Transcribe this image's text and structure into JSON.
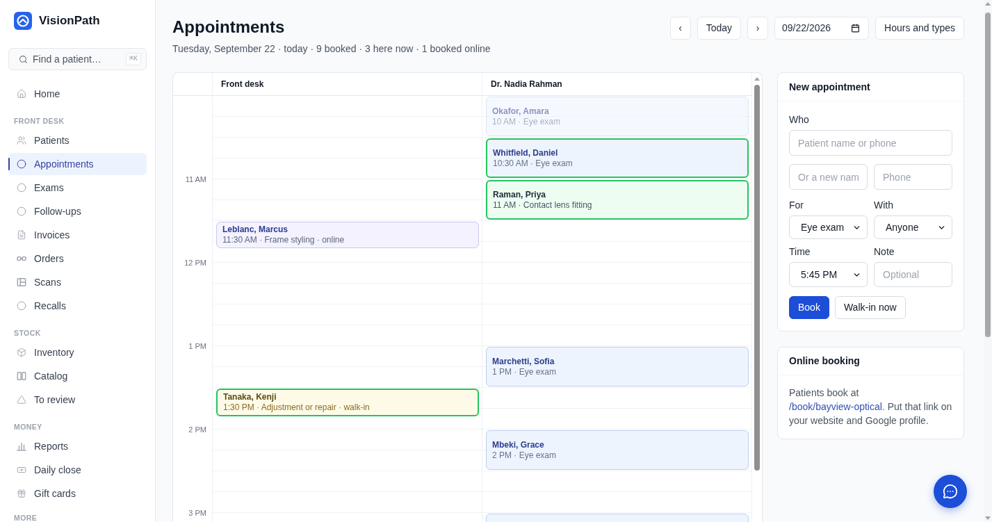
{
  "sidebar": {
    "brand": "VisionPath",
    "search": {
      "placeholder": "Find a patient…",
      "shortcut": "⌘K"
    },
    "sections": [
      {
        "items": [
          {
            "label": "Home",
            "selected": false
          }
        ]
      },
      {
        "title": "FRONT DESK",
        "items": [
          {
            "label": "Patients",
            "selected": false
          },
          {
            "label": "Appointments",
            "selected": true
          },
          {
            "label": "Exams",
            "selected": false
          },
          {
            "label": "Follow-ups",
            "selected": false
          },
          {
            "label": "Invoices",
            "selected": false
          },
          {
            "label": "Orders",
            "selected": false
          },
          {
            "label": "Scans",
            "selected": false
          },
          {
            "label": "Recalls",
            "selected": false
          }
        ]
      },
      {
        "title": "STOCK",
        "items": [
          {
            "label": "Inventory",
            "selected": false
          },
          {
            "label": "Catalog",
            "selected": false
          },
          {
            "label": "To review",
            "selected": false
          }
        ]
      },
      {
        "title": "MONEY",
        "items": [
          {
            "label": "Reports",
            "selected": false
          },
          {
            "label": "Daily close",
            "selected": false
          },
          {
            "label": "Gift cards",
            "selected": false
          }
        ]
      },
      {
        "title": "MORE"
      }
    ]
  },
  "header": {
    "title": "Appointments",
    "summary": "Tuesday, September 22 · today · 9 booked · 3 here now · 1 booked online",
    "prev": "‹",
    "today": "Today",
    "next": "›",
    "date": "09/22/2026",
    "hours_button": "Hours and types"
  },
  "calendar": {
    "hours": [
      "11 AM",
      "12 PM",
      "1 PM",
      "2 PM",
      "3 PM"
    ],
    "columns": [
      {
        "title": "Front desk",
        "slots": [
          {
            "kind": "open"
          },
          {
            "kind": "open"
          },
          {
            "kind": "open"
          },
          {
            "kind": "open"
          },
          {
            "kind": "open"
          },
          {
            "kind": "open"
          },
          {
            "kind": "styling",
            "name": "Leblanc, Marcus",
            "detail": "11:30 AM · Frame styling · online",
            "here_now": false,
            "past": false
          },
          {
            "kind": "open"
          },
          {
            "kind": "open"
          },
          {
            "kind": "open"
          },
          {
            "kind": "open"
          },
          {
            "kind": "open"
          },
          {
            "kind": "open"
          },
          {
            "kind": "open"
          },
          {
            "kind": "repair",
            "name": "Tanaka, Kenji",
            "detail": "1:30 PM · Adjustment or repair · walk-in",
            "here_now": true,
            "past": false
          },
          {
            "kind": "open"
          },
          {
            "kind": "open"
          },
          {
            "kind": "open"
          },
          {
            "kind": "open"
          },
          {
            "kind": "open"
          },
          {
            "kind": "open"
          }
        ]
      },
      {
        "title": "Dr. Nadia Rahman",
        "slots": [
          {
            "kind": "exam",
            "name": "Okafor, Amara",
            "detail": "10 AM · Eye exam",
            "here_now": false,
            "past": true
          },
          {
            "kind": "open"
          },
          {
            "kind": "exam",
            "name": "Whitfield, Daniel",
            "detail": "10:30 AM · Eye exam",
            "here_now": true,
            "past": false
          },
          {
            "kind": "open"
          },
          {
            "kind": "lens",
            "name": "Raman, Priya",
            "detail": "11 AM · Contact lens fitting",
            "here_now": true,
            "past": false
          },
          {
            "kind": "open"
          },
          {
            "kind": "open"
          },
          {
            "kind": "open"
          },
          {
            "kind": "open"
          },
          {
            "kind": "open"
          },
          {
            "kind": "open"
          },
          {
            "kind": "open"
          },
          {
            "kind": "exam",
            "name": "Marchetti, Sofia",
            "detail": "1 PM · Eye exam",
            "here_now": false,
            "past": false
          },
          {
            "kind": "open"
          },
          {
            "kind": "open"
          },
          {
            "kind": "open"
          },
          {
            "kind": "exam",
            "name": "Mbeki, Grace",
            "detail": "2 PM · Eye exam",
            "here_now": false,
            "past": false
          },
          {
            "kind": "open"
          },
          {
            "kind": "open"
          },
          {
            "kind": "open"
          },
          {
            "kind": "exam",
            "here_now": false,
            "past": false
          }
        ]
      }
    ]
  },
  "new_appointment": {
    "title": "New appointment",
    "who": {
      "label": "Who",
      "placeholder": "Patient name or phone"
    },
    "new_name": {
      "placeholder": "Or a new nam"
    },
    "phone": {
      "placeholder": "Phone"
    },
    "for": {
      "label": "For",
      "value": "Eye exam"
    },
    "with": {
      "label": "With",
      "value": "Anyone"
    },
    "time": {
      "label": "Time",
      "value": "5:45 PM"
    },
    "note": {
      "label": "Note",
      "placeholder": "Optional"
    },
    "buttons": [
      {
        "label": "Book",
        "kind": "primary"
      },
      {
        "label": "Walk-in now",
        "kind": "secondary"
      }
    ]
  },
  "online_booking": {
    "title": "Online booking",
    "text": "Patients book at",
    "link": "/book/bayview-optical",
    "text_after": ". Put that link on your website and Google profile."
  }
}
